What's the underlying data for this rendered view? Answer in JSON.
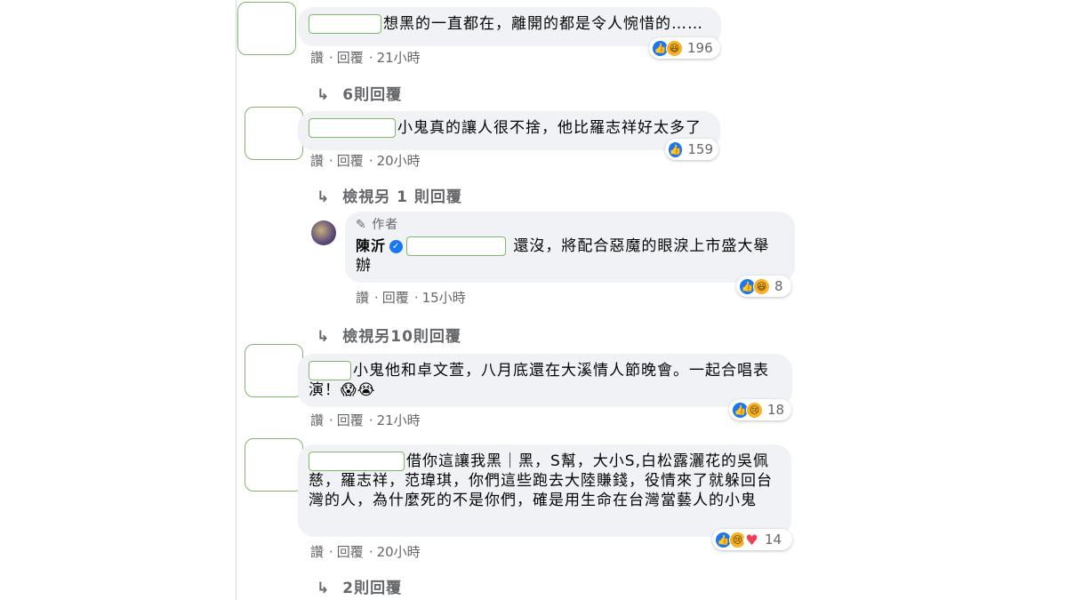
{
  "comments": [
    {
      "text": "想黑的一直都在，離開的都是令人惋惜的……",
      "actions": {
        "like": "讚",
        "reply": "回覆",
        "time": "21小時"
      },
      "reactions": {
        "icons": [
          "like-icon",
          "haha-icon"
        ],
        "count": "196"
      },
      "replies_link": "6則回覆"
    },
    {
      "text": "小鬼真的讓人很不捨，他比羅志祥好太多了",
      "actions": {
        "like": "讚",
        "reply": "回覆",
        "time": "20小時"
      },
      "reactions": {
        "icons": [
          "like-icon"
        ],
        "count": "159"
      },
      "replies_link": "檢視另 1 則回覆"
    },
    {
      "text": "小鬼他和卓文萱，八月底還在大溪情人節晚會。一起合唱表演！😱😭",
      "actions": {
        "like": "讚",
        "reply": "回覆",
        "time": "21小時"
      },
      "reactions": {
        "icons": [
          "like-icon",
          "sad-icon"
        ],
        "count": "18"
      }
    },
    {
      "text": "借你這讓我黑｜黑，S幫，大小S,白松露灑花的吳佩慈，羅志祥，范瑋琪，你們這些跑去大陸賺錢，役情來了就躲回台灣的人，為什麼死的不是你們，確是用生命在台灣當藝人的小鬼",
      "actions": {
        "like": "讚",
        "reply": "回覆",
        "time": "20小時"
      },
      "reactions": {
        "icons": [
          "like-icon",
          "sad-icon",
          "love-icon"
        ],
        "count": "14"
      },
      "replies_link": "2則回覆"
    }
  ],
  "author_reply": {
    "badge": "作者",
    "name": "陳沂",
    "text": "還沒，將配合惡魔的眼淚上市盛大舉辦",
    "actions": {
      "like": "讚",
      "reply": "回覆",
      "time": "15小時"
    },
    "reactions": {
      "icons": [
        "like-icon",
        "haha-icon"
      ],
      "count": "8"
    }
  },
  "more_replies_link": "檢視另10則回覆",
  "colors": {
    "like": "#1877f2",
    "love": "#f33e58",
    "bubble": "#f0f2f5",
    "muted": "#65676b"
  }
}
